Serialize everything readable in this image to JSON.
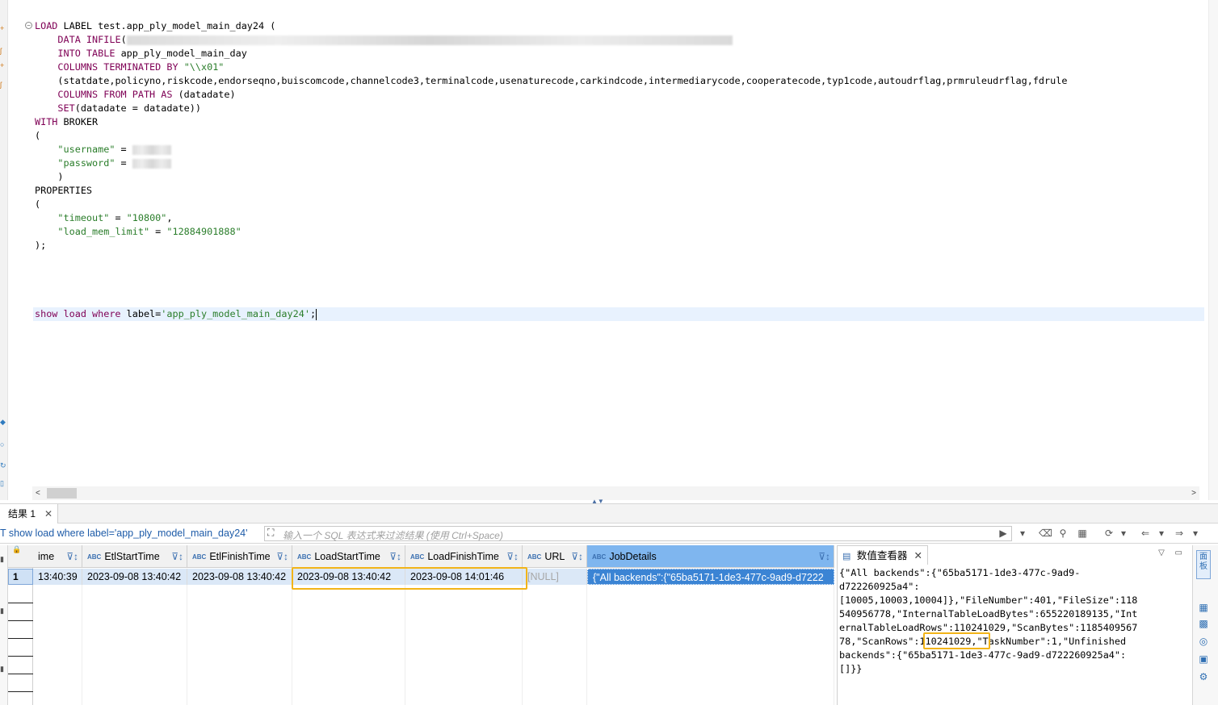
{
  "editor": {
    "lines": [
      {
        "parts": [
          [
            "kw",
            "LOAD "
          ],
          [
            "plain",
            "LABEL test.app_ply_model_main_day24 ("
          ]
        ]
      },
      {
        "indent": "    ",
        "parts": [
          [
            "kw",
            "DATA INFILE"
          ],
          [
            "plain",
            "("
          ]
        ],
        "blur_width": 750
      },
      {
        "indent": "    ",
        "parts": [
          [
            "kw",
            "INTO TABLE "
          ],
          [
            "plain",
            "app_ply_model_main_day"
          ]
        ]
      },
      {
        "indent": "    ",
        "parts": [
          [
            "kw",
            "COLUMNS TERMINATED BY "
          ],
          [
            "str",
            "\"\\\\x01\""
          ]
        ]
      },
      {
        "indent": "    ",
        "parts": [
          [
            "plain",
            "(statdate,policyno,riskcode,endorseqno,buiscomcode,channelcode3,terminalcode,usenaturecode,carkindcode,intermediarycode,cooperatecode,typ1code,autoudrflag,prmruleudrflag,fdrule"
          ]
        ]
      },
      {
        "indent": "    ",
        "parts": [
          [
            "kw",
            "COLUMNS FROM PATH AS "
          ],
          [
            "plain",
            "(datadate)"
          ]
        ]
      },
      {
        "indent": "    ",
        "parts": [
          [
            "kw",
            "SET"
          ],
          [
            "plain",
            "(datadate = datadate))"
          ]
        ]
      },
      {
        "parts": [
          [
            "kw",
            "WITH "
          ],
          [
            "plain",
            "BROKER"
          ]
        ]
      },
      {
        "parts": [
          [
            "plain",
            "("
          ]
        ]
      },
      {
        "indent": "    ",
        "parts": [
          [
            "str",
            "\"username\""
          ],
          [
            "plain",
            " = "
          ]
        ],
        "blur_width": 48
      },
      {
        "indent": "    ",
        "parts": [
          [
            "str",
            "\"password\""
          ],
          [
            "plain",
            " = "
          ]
        ],
        "blur_width": 48
      },
      {
        "indent": "    ",
        "parts": [
          [
            "plain",
            ")"
          ]
        ]
      },
      {
        "parts": [
          [
            "plain",
            "PROPERTIES"
          ]
        ]
      },
      {
        "parts": [
          [
            "plain",
            "("
          ]
        ]
      },
      {
        "indent": "    ",
        "parts": [
          [
            "str",
            "\"timeout\""
          ],
          [
            "plain",
            " = "
          ],
          [
            "str",
            "\"10800\""
          ],
          [
            "plain",
            ","
          ]
        ]
      },
      {
        "indent": "    ",
        "parts": [
          [
            "str",
            "\"load_mem_limit\""
          ],
          [
            "plain",
            " = "
          ],
          [
            "str",
            "\"12884901888\""
          ]
        ]
      },
      {
        "parts": [
          [
            "plain",
            ");"
          ]
        ]
      },
      {
        "parts": []
      },
      {
        "parts": []
      },
      {
        "parts": []
      },
      {
        "parts": []
      },
      {
        "parts": [
          [
            "kw",
            "show load where "
          ],
          [
            "plain",
            "label="
          ],
          [
            "str",
            "'app_ply_model_main_day24'"
          ],
          [
            "plain",
            ";"
          ]
        ],
        "caret": true
      }
    ]
  },
  "results_tab": {
    "label": "结果 1"
  },
  "query_text": "T show load where label='app_ply_model_main_day24'",
  "filter_placeholder": "输入一个 SQL 表达式来过滤结果 (使用 Ctrl+Space)",
  "grid": {
    "columns": [
      {
        "label": "ime",
        "abc": false
      },
      {
        "label": "EtlStartTime",
        "abc": true
      },
      {
        "label": "EtlFinishTime",
        "abc": true
      },
      {
        "label": "LoadStartTime",
        "abc": true
      },
      {
        "label": "LoadFinishTime",
        "abc": true
      },
      {
        "label": "URL",
        "abc": true
      },
      {
        "label": "JobDetails",
        "abc": true
      }
    ],
    "abc_label": "ABC",
    "row_number": "1",
    "row": [
      "13:40:39",
      "2023-09-08 13:40:42",
      "2023-09-08 13:40:42",
      "2023-09-08 13:40:42",
      "2023-09-08 14:01:46",
      "[NULL]",
      "{\"All backends\":{\"65ba5171-1de3-477c-9ad9-d7222"
    ]
  },
  "viewer": {
    "title": "数值查看器",
    "lines": [
      "{\"All backends\":{\"65ba5171-1de3-477c-9ad9-",
      "d722260925a4\":",
      "[10005,10003,10004]},\"FileNumber\":401,\"FileSize\":118",
      "540956778,\"InternalTableLoadBytes\":655220189135,\"Int",
      "ernalTableLoadRows\":110241029,\"ScanBytes\":1185409567",
      "78,\"ScanRows\":110241029,\"TaskNumber\":1,\"Unfinished",
      "backends\":{\"65ba5171-1de3-477c-9ad9-d722260925a4\":",
      "[]}}"
    ]
  },
  "right_toolbar": {
    "panel_label": "面板"
  },
  "colors": {
    "highlight": "#f2b418",
    "selected_header": "#7fb6ef",
    "selected_cell": "#3b84d4",
    "keyword": "#7f0055",
    "string": "#2a7d2a"
  }
}
